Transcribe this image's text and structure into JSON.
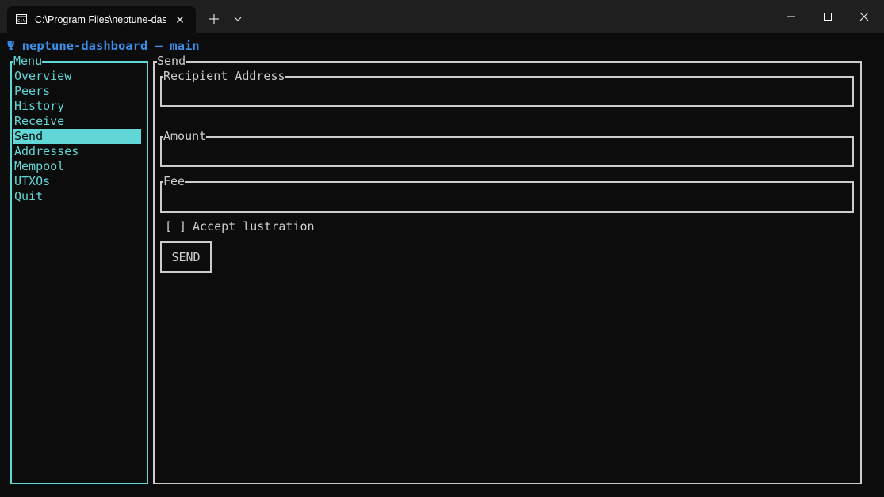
{
  "window": {
    "tab_title": "C:\\Program Files\\neptune-dashboard\\neptune-dashboard.exe",
    "tab_icon": "terminal-icon",
    "close_tab_glyph": "✕",
    "new_tab_icon": "plus-icon",
    "dropdown_icon": "chevron-down-icon",
    "controls": [
      "minimize-icon",
      "maximize-icon",
      "close-icon"
    ]
  },
  "app": {
    "title": "Ψ neptune-dashboard – main"
  },
  "menu": {
    "title": "Menu",
    "items": [
      "Overview",
      "Peers",
      "History",
      "Receive",
      "Send",
      "Addresses",
      "Mempool",
      "UTXOs",
      "Quit"
    ],
    "selected": "Send"
  },
  "send": {
    "title": "Send",
    "fields": {
      "recipient_label": "Recipient Address",
      "recipient_value": "",
      "amount_label": "Amount",
      "amount_value": "",
      "fee_label": "Fee",
      "fee_value": ""
    },
    "checkbox": "[ ]",
    "checkbox_label": "Accept lustration",
    "button": "SEND"
  },
  "colors": {
    "background": "#0c0c0c",
    "titlebar": "#1f1f1f",
    "menu_accent": "#61d6d6",
    "app_title": "#3b8eea",
    "text": "#cccccc"
  }
}
